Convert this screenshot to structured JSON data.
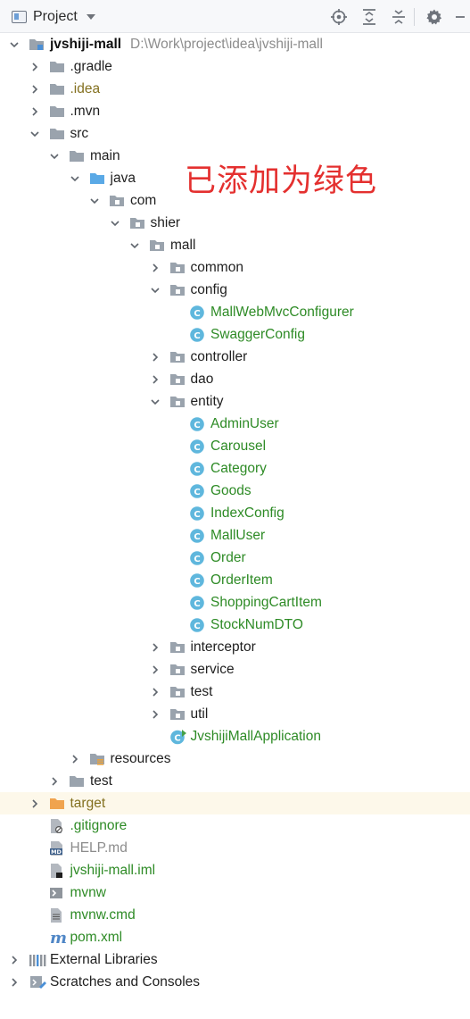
{
  "toolbar": {
    "title": "Project",
    "icons": [
      "locate-icon",
      "expand-all-icon",
      "collapse-all-icon",
      "settings-gear-icon"
    ]
  },
  "annotation": "已添加为绿色",
  "colors": {
    "green": "#2e8b26",
    "class_icon": "#5fb7dd",
    "folder": "#9aa3ad",
    "folder_source": "#5aa9e6",
    "folder_excluded": "#f0a34e",
    "annotation": "#e4302f",
    "selected_row": "#fdf8ea"
  },
  "tree": [
    {
      "label": "jvshiji-mall",
      "path": "D:\\Work\\project\\idea\\jvshiji-mall",
      "depth": 0,
      "arrow": "open",
      "icon": "module-folder",
      "style": "bold"
    },
    {
      "label": ".gradle",
      "depth": 1,
      "arrow": "closed",
      "icon": "folder",
      "style": "normal"
    },
    {
      "label": ".idea",
      "depth": 1,
      "arrow": "closed",
      "icon": "folder",
      "style": "olive"
    },
    {
      "label": ".mvn",
      "depth": 1,
      "arrow": "closed",
      "icon": "folder",
      "style": "normal"
    },
    {
      "label": "src",
      "depth": 1,
      "arrow": "open",
      "icon": "folder",
      "style": "normal"
    },
    {
      "label": "main",
      "depth": 2,
      "arrow": "open",
      "icon": "folder",
      "style": "normal"
    },
    {
      "label": "java",
      "depth": 3,
      "arrow": "open",
      "icon": "source-folder",
      "style": "normal"
    },
    {
      "label": "com",
      "depth": 4,
      "arrow": "open",
      "icon": "package",
      "style": "normal"
    },
    {
      "label": "shier",
      "depth": 5,
      "arrow": "open",
      "icon": "package",
      "style": "normal"
    },
    {
      "label": "mall",
      "depth": 6,
      "arrow": "open",
      "icon": "package",
      "style": "normal"
    },
    {
      "label": "common",
      "depth": 7,
      "arrow": "closed",
      "icon": "package",
      "style": "normal"
    },
    {
      "label": "config",
      "depth": 7,
      "arrow": "open",
      "icon": "package",
      "style": "normal"
    },
    {
      "label": "MallWebMvcConfigurer",
      "depth": 8,
      "arrow": "none",
      "icon": "class",
      "style": "green"
    },
    {
      "label": "SwaggerConfig",
      "depth": 8,
      "arrow": "none",
      "icon": "class",
      "style": "green"
    },
    {
      "label": "controller",
      "depth": 7,
      "arrow": "closed",
      "icon": "package",
      "style": "normal"
    },
    {
      "label": "dao",
      "depth": 7,
      "arrow": "closed",
      "icon": "package",
      "style": "normal"
    },
    {
      "label": "entity",
      "depth": 7,
      "arrow": "open",
      "icon": "package",
      "style": "normal"
    },
    {
      "label": "AdminUser",
      "depth": 8,
      "arrow": "none",
      "icon": "class",
      "style": "green"
    },
    {
      "label": "Carousel",
      "depth": 8,
      "arrow": "none",
      "icon": "class",
      "style": "green"
    },
    {
      "label": "Category",
      "depth": 8,
      "arrow": "none",
      "icon": "class",
      "style": "green"
    },
    {
      "label": "Goods",
      "depth": 8,
      "arrow": "none",
      "icon": "class",
      "style": "green"
    },
    {
      "label": "IndexConfig",
      "depth": 8,
      "arrow": "none",
      "icon": "class",
      "style": "green"
    },
    {
      "label": "MallUser",
      "depth": 8,
      "arrow": "none",
      "icon": "class",
      "style": "green"
    },
    {
      "label": "Order",
      "depth": 8,
      "arrow": "none",
      "icon": "class",
      "style": "green"
    },
    {
      "label": "OrderItem",
      "depth": 8,
      "arrow": "none",
      "icon": "class",
      "style": "green"
    },
    {
      "label": "ShoppingCartItem",
      "depth": 8,
      "arrow": "none",
      "icon": "class",
      "style": "green"
    },
    {
      "label": "StockNumDTO",
      "depth": 8,
      "arrow": "none",
      "icon": "class",
      "style": "green"
    },
    {
      "label": "interceptor",
      "depth": 7,
      "arrow": "closed",
      "icon": "package",
      "style": "normal"
    },
    {
      "label": "service",
      "depth": 7,
      "arrow": "closed",
      "icon": "package",
      "style": "normal"
    },
    {
      "label": "test",
      "depth": 7,
      "arrow": "closed",
      "icon": "package",
      "style": "normal"
    },
    {
      "label": "util",
      "depth": 7,
      "arrow": "closed",
      "icon": "package",
      "style": "normal"
    },
    {
      "label": "JvshijiMallApplication",
      "depth": 7,
      "arrow": "none",
      "icon": "spring-class",
      "style": "green"
    },
    {
      "label": "resources",
      "depth": 3,
      "arrow": "closed",
      "icon": "resources-folder",
      "style": "normal"
    },
    {
      "label": "test",
      "depth": 2,
      "arrow": "closed",
      "icon": "folder",
      "style": "normal"
    },
    {
      "label": "target",
      "depth": 1,
      "arrow": "closed",
      "icon": "excluded-folder",
      "style": "olive",
      "selected": true
    },
    {
      "label": ".gitignore",
      "depth": 1,
      "arrow": "none",
      "icon": "ignored-file",
      "style": "green"
    },
    {
      "label": "HELP.md",
      "depth": 1,
      "arrow": "none",
      "icon": "markdown-file",
      "style": "gray"
    },
    {
      "label": "jvshiji-mall.iml",
      "depth": 1,
      "arrow": "none",
      "icon": "iml-file",
      "style": "green"
    },
    {
      "label": "mvnw",
      "depth": 1,
      "arrow": "none",
      "icon": "shell-file",
      "style": "green"
    },
    {
      "label": "mvnw.cmd",
      "depth": 1,
      "arrow": "none",
      "icon": "text-file",
      "style": "green"
    },
    {
      "label": "pom.xml",
      "depth": 1,
      "arrow": "none",
      "icon": "maven-file",
      "style": "green"
    },
    {
      "label": "External Libraries",
      "depth": 0,
      "arrow": "closed",
      "icon": "libraries",
      "style": "normal"
    },
    {
      "label": "Scratches and Consoles",
      "depth": 0,
      "arrow": "closed",
      "icon": "scratches",
      "style": "normal"
    }
  ]
}
